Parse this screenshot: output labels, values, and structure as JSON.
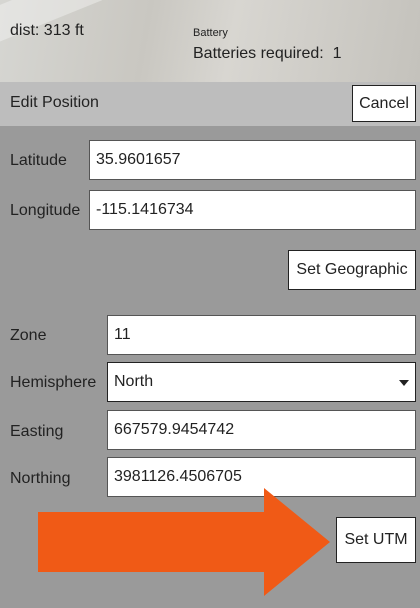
{
  "status": {
    "dist_label": "dist:",
    "dist_value": "313 ft",
    "battery_title": "Battery",
    "batteries_required": "Batteries required:  1"
  },
  "header": {
    "title": "Edit Position",
    "cancel_label": "Cancel"
  },
  "geographic": {
    "latitude_label": "Latitude",
    "latitude_value": "35.9601657",
    "longitude_label": "Longitude",
    "longitude_value": "-115.1416734",
    "set_label": "Set Geographic"
  },
  "utm": {
    "zone_label": "Zone",
    "zone_value": "11",
    "hemisphere_label": "Hemisphere",
    "hemisphere_value": "North",
    "easting_label": "Easting",
    "easting_value": "667579.9454742",
    "northing_label": "Northing",
    "northing_value": "3981126.4506705",
    "set_label": "Set UTM"
  },
  "colors": {
    "panel_bg": "#9a9a9a",
    "header_bg": "#bdbdbd",
    "arrow": "#f05a16"
  },
  "icons": {
    "select_caret": "chevron-down-icon",
    "highlight": "arrow-right-icon"
  }
}
